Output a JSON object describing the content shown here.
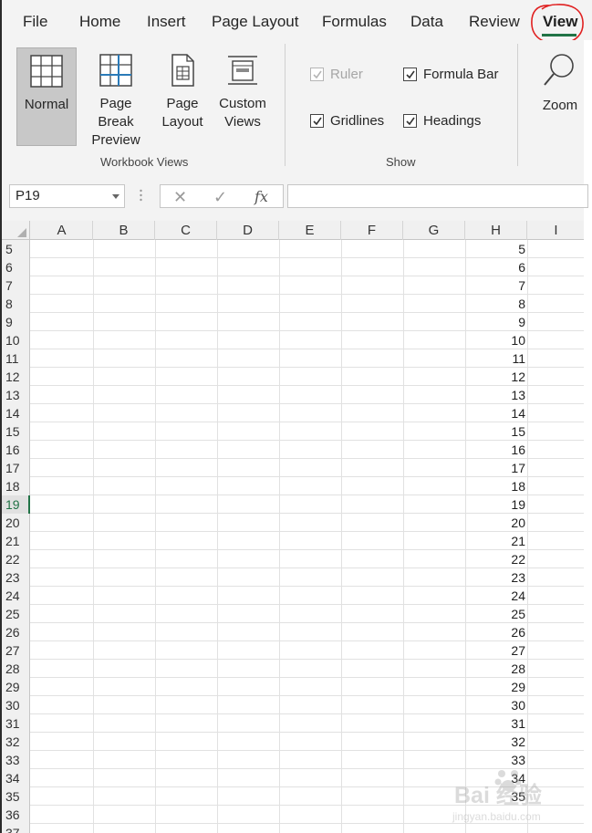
{
  "tabs": {
    "file": "File",
    "home": "Home",
    "insert": "Insert",
    "page_layout": "Page Layout",
    "formulas": "Formulas",
    "data": "Data",
    "review": "Review",
    "view": "View"
  },
  "ribbon": {
    "workbook_views": {
      "label": "Workbook Views",
      "normal": "Normal",
      "page_break_line1": "Page Break",
      "page_break_line2": "Preview",
      "page_layout_line1": "Page",
      "page_layout_line2": "Layout",
      "custom_views_line1": "Custom",
      "custom_views_line2": "Views"
    },
    "show": {
      "label": "Show",
      "ruler": "Ruler",
      "formula_bar": "Formula Bar",
      "gridlines": "Gridlines",
      "headings": "Headings",
      "ruler_checked": true,
      "ruler_enabled": false,
      "formula_bar_checked": true,
      "gridlines_checked": true,
      "headings_checked": true
    },
    "zoom": {
      "label": "Zoom"
    }
  },
  "formula_bar": {
    "name_box": "P19",
    "cancel_icon": "✕",
    "enter_icon": "✓",
    "fx_label": "fx",
    "value": ""
  },
  "grid": {
    "columns": [
      "A",
      "B",
      "C",
      "D",
      "E",
      "F",
      "G",
      "H",
      "I"
    ],
    "selected_row": "19",
    "rows": [
      {
        "n": "5",
        "h": "5"
      },
      {
        "n": "6",
        "h": "6"
      },
      {
        "n": "7",
        "h": "7"
      },
      {
        "n": "8",
        "h": "8"
      },
      {
        "n": "9",
        "h": "9"
      },
      {
        "n": "10",
        "h": "10"
      },
      {
        "n": "11",
        "h": "11"
      },
      {
        "n": "12",
        "h": "12"
      },
      {
        "n": "13",
        "h": "13"
      },
      {
        "n": "14",
        "h": "14"
      },
      {
        "n": "15",
        "h": "15"
      },
      {
        "n": "16",
        "h": "16"
      },
      {
        "n": "17",
        "h": "17"
      },
      {
        "n": "18",
        "h": "18"
      },
      {
        "n": "19",
        "h": "19"
      },
      {
        "n": "20",
        "h": "20"
      },
      {
        "n": "21",
        "h": "21"
      },
      {
        "n": "22",
        "h": "22"
      },
      {
        "n": "23",
        "h": "23"
      },
      {
        "n": "24",
        "h": "24"
      },
      {
        "n": "25",
        "h": "25"
      },
      {
        "n": "26",
        "h": "26"
      },
      {
        "n": "27",
        "h": "27"
      },
      {
        "n": "28",
        "h": "28"
      },
      {
        "n": "29",
        "h": "29"
      },
      {
        "n": "30",
        "h": "30"
      },
      {
        "n": "31",
        "h": "31"
      },
      {
        "n": "32",
        "h": "32"
      },
      {
        "n": "33",
        "h": "33"
      },
      {
        "n": "34",
        "h": "34"
      },
      {
        "n": "35",
        "h": "35"
      },
      {
        "n": "36",
        "h": ""
      },
      {
        "n": "37",
        "h": ""
      }
    ]
  },
  "watermark": {
    "line1": "Bai 经验",
    "line2": "jingyan.baidu.com"
  },
  "colors": {
    "accent": "#217346",
    "annotation": "#e02020",
    "ribbon_bg": "#f3f3f3"
  }
}
